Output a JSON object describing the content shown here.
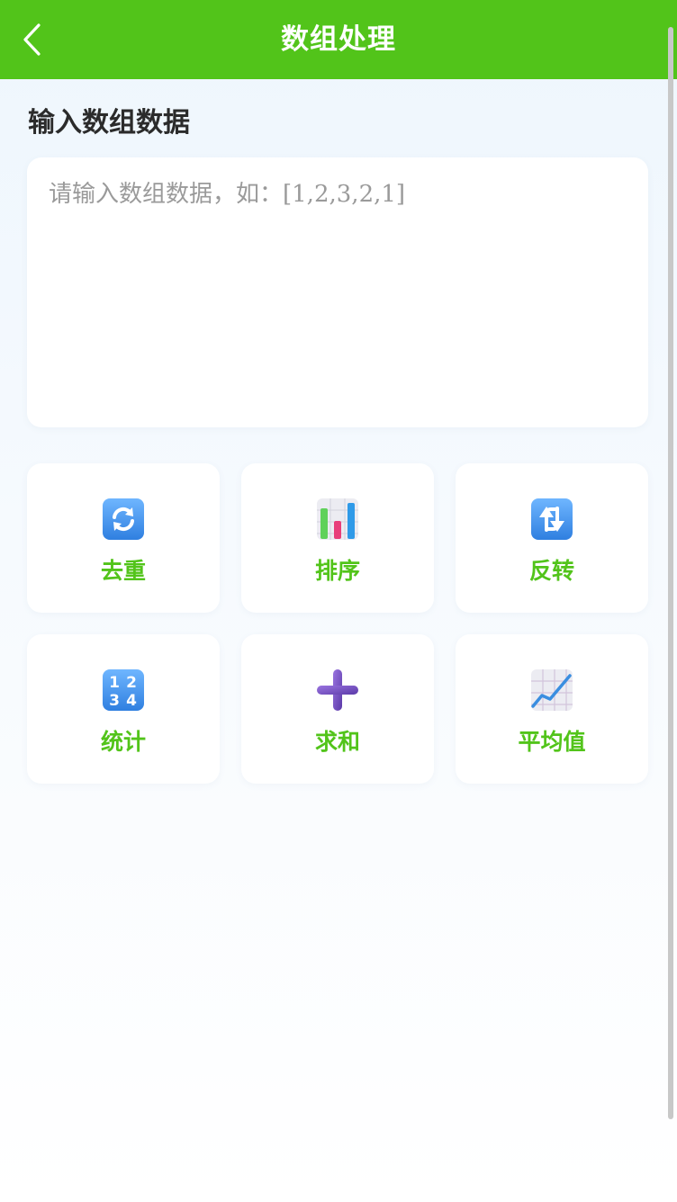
{
  "header": {
    "title": "数组处理",
    "accent_color": "#52c41a",
    "back_icon": "chevron-left-icon"
  },
  "input_section": {
    "title": "输入数组数据",
    "placeholder": "请输入数组数据，如：[1,2,3,2,1]",
    "value": ""
  },
  "actions": [
    {
      "label": "去重",
      "icon": "refresh-arrows-icon"
    },
    {
      "label": "排序",
      "icon": "bar-chart-icon"
    },
    {
      "label": "反转",
      "icon": "swap-vertical-icon"
    },
    {
      "label": "统计",
      "icon": "number-keypad-icon"
    },
    {
      "label": "求和",
      "icon": "plus-icon"
    },
    {
      "label": "平均值",
      "icon": "trend-chart-icon"
    }
  ]
}
